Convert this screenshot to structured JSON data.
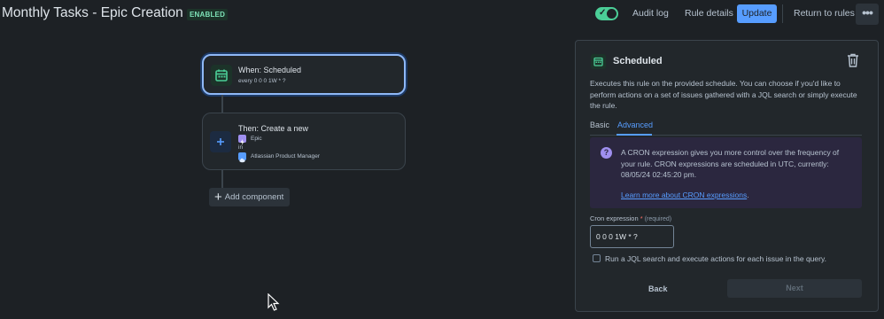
{
  "header": {
    "title": "Monthly Tasks - Epic Creation",
    "status_badge": "ENABLED",
    "toggle_on": true,
    "audit_log": "Audit log",
    "rule_details": "Rule details",
    "update": "Update",
    "return_to_rules": "Return to rules"
  },
  "canvas": {
    "trigger": {
      "title": "When: Scheduled",
      "subtitle": "every 0 0 0 1W * ?"
    },
    "action": {
      "title": "Then: Create a new",
      "issue_type": "Epic",
      "in_label": "in",
      "project": "Atlassian Product Manager"
    },
    "add_component": "Add component"
  },
  "panel": {
    "title": "Scheduled",
    "description": "Executes this rule on the provided schedule. You can choose if you'd like to perform actions on a set of issues gathered with a JQL search or simply execute the rule.",
    "tabs": [
      {
        "label": "Basic",
        "active": false
      },
      {
        "label": "Advanced",
        "active": true
      }
    ],
    "info": {
      "text": "A CRON expression gives you more control over the frequency of your rule. CRON expressions are scheduled in UTC, currently: 08/05/24 02:45:20 pm.",
      "link_text": "Learn more about CRON expressions",
      "link_suffix": "."
    },
    "cron_label": "Cron expression",
    "cron_required_mark": "*",
    "cron_hint": "(required)",
    "cron_value": "0 0 0 1W * ?",
    "jql_checkbox_label": "Run a JQL search and execute actions for each issue in the query.",
    "jql_checked": false,
    "back": "Back",
    "next": "Next"
  },
  "colors": {
    "background": "#1d2125",
    "accent": "#579dff",
    "enabled_green": "#4bce97",
    "trigger_icon": "#4bce97",
    "action_icon": "#579dff",
    "info_bg": "#2b273f",
    "info_icon": "#9f8fef"
  },
  "icons": {
    "trigger": "calendar-icon",
    "action": "plus-icon",
    "issue_type": "epic-lightning-icon",
    "project": "cloud-project-icon",
    "delete": "trash-icon",
    "more": "ellipsis-icon",
    "info": "question-circle-icon"
  }
}
